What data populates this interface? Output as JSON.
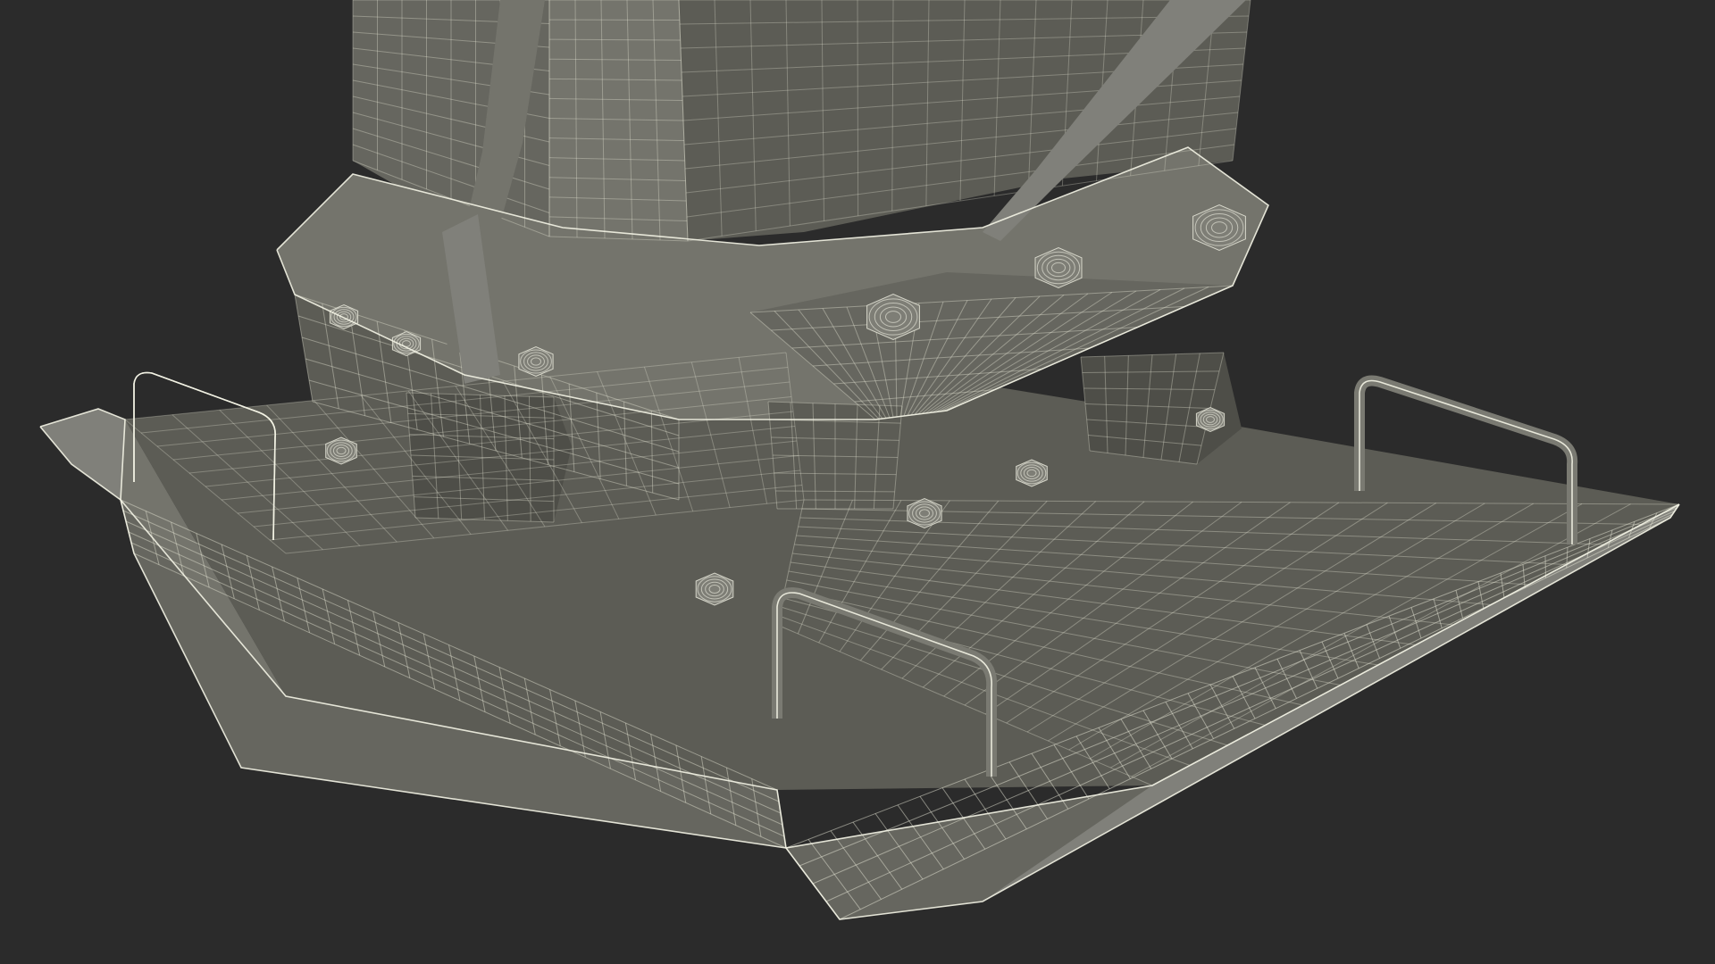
{
  "scene": {
    "subject": "plate-compactor-base",
    "render_mode": "wireframe-on-shaded",
    "colors": {
      "background": "#2b2b2b",
      "surface_light": "#80807a",
      "surface_mid": "#6a6a63",
      "surface_dark": "#4e4e48",
      "wire": "#e8e8d8"
    }
  }
}
